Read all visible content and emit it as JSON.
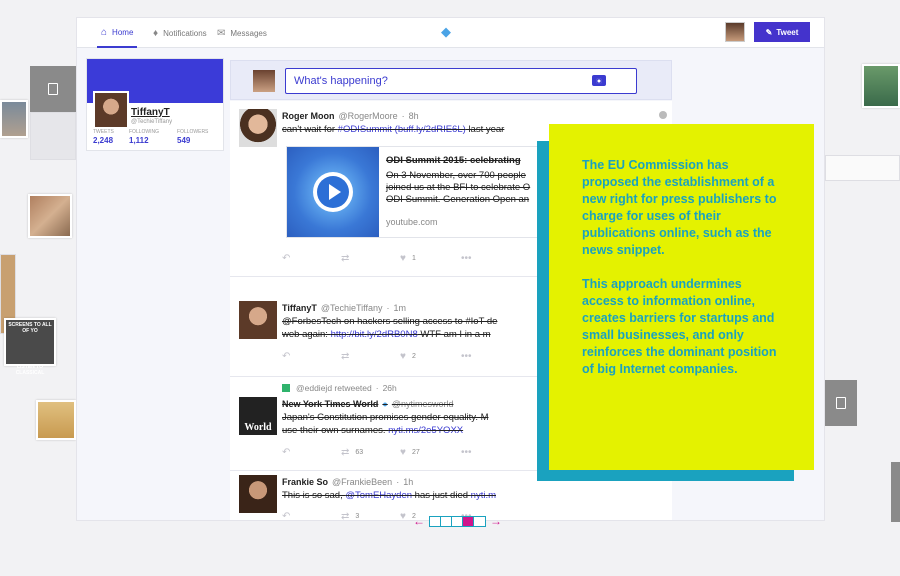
{
  "nav": {
    "home": "Home",
    "notifications": "Notifications",
    "messages": "Messages",
    "tweet_button": "Tweet"
  },
  "profile": {
    "name": "TiffanyT",
    "handle": "@TechieTiffany",
    "stats": [
      {
        "label": "TWEETS",
        "value": "2,248"
      },
      {
        "label": "FOLLOWING",
        "value": "1,112"
      },
      {
        "label": "FOLLOWERS",
        "value": "549"
      }
    ]
  },
  "compose": {
    "placeholder": "What's happening?"
  },
  "tweets": [
    {
      "name": "Roger Moon",
      "handle": "@RogerMoore",
      "time": "8h",
      "text_plain": "can't wait for ",
      "text_link": "#ODISummit (buff.ly/2dRIE6L)",
      "text_after": " last year",
      "card": {
        "title": "ODI Summit 2015: celebrating",
        "desc1": "On 3 November, over 700 people",
        "desc2": "joined us at the BFI to celebrate O",
        "desc3": "ODI Summit. Generation Open an",
        "domain": "youtube.com"
      },
      "likes": "1"
    },
    {
      "name": "TiffanyT",
      "handle": "@TechieTiffany",
      "time": "1m",
      "line1": "@ForbesTech on hackers selling access to #IoT de",
      "line2_plain": "web again: ",
      "line2_link": "http://bit.ly/2dRB0N8",
      "line2_after": " WTF am I in a m",
      "likes": "2"
    },
    {
      "retweeted_by": "@eddiejd retweeted",
      "rt_time": "26h",
      "name": "New York Times World",
      "handle": "@nytimesworld",
      "line1": "Japan's Constitution promises gender equality. M",
      "line2_plain": "use their own surnames. ",
      "line2_link": "nyti.ms/2e5YOXX",
      "avatar_text": "World",
      "retweets": "63",
      "likes": "27"
    },
    {
      "name": "Frankie So",
      "handle": "@FrankieBeen",
      "time": "1h",
      "line1_plain": "This is so sad, ",
      "line1_link": "@TomEHayden",
      "line1_after": " has just died ",
      "line1_link2": "nyti.m",
      "retweets": "3",
      "likes": "2"
    }
  ],
  "callout": {
    "paragraph1": "The EU Commission has proposed the establishment of a new right for press publishers to charge for uses of their publications online, such as the news snippet.",
    "paragraph2": "This approach undermines access to information online, creates barriers for startups and small businesses, and only reinforces the dominant position of big Internet companies."
  },
  "background_meme_text": {
    "top": "SCREENS TO ALL OF YO",
    "bottom": "LISTEN TO CLASSICAL"
  },
  "pager": {
    "prev": "←",
    "next": "→",
    "total": 5,
    "active": 4
  },
  "colors": {
    "accent": "#3b3bd0",
    "callout_bg": "#e4f200",
    "callout_text": "#1aa2bf",
    "pager_active": "#d0158c"
  }
}
